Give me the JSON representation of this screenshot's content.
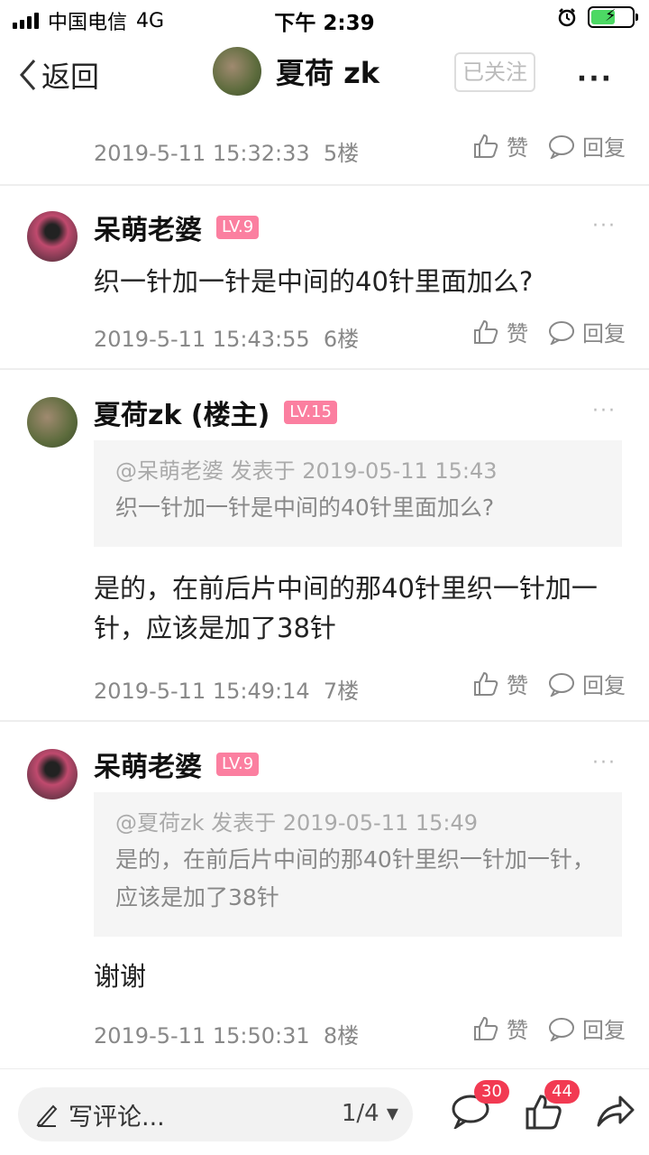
{
  "status_bar": {
    "carrier": "中国电信",
    "network": "4G",
    "time": "下午 2:39"
  },
  "nav": {
    "back_label": "返回",
    "title": "夏荷 zk",
    "follow_label": "已关注",
    "more_label": "···"
  },
  "post0": {
    "time": "2019-5-11 15:32:33",
    "floor": "5楼",
    "like_label": "赞",
    "reply_label": "回复"
  },
  "post1": {
    "name": "呆萌老婆",
    "level": "LV.9",
    "text": "织一针加一针是中间的40针里面加么?",
    "time": "2019-5-11 15:43:55",
    "floor": "6楼",
    "like_label": "赞",
    "reply_label": "回复"
  },
  "post2": {
    "name": "夏荷zk (楼主)",
    "level": "LV.15",
    "quote_head": "@呆萌老婆 发表于 2019-05-11 15:43",
    "quote_text": "织一针加一针是中间的40针里面加么?",
    "text": "是的，在前后片中间的那40针里织一针加一针，应该是加了38针",
    "time": "2019-5-11 15:49:14",
    "floor": "7楼",
    "like_label": "赞",
    "reply_label": "回复"
  },
  "post3": {
    "name": "呆萌老婆",
    "level": "LV.9",
    "quote_head": "@夏荷zk 发表于 2019-05-11 15:49",
    "quote_text": "是的，在前后片中间的那40针里织一针加一针，应该是加了38针",
    "text": "谢谢",
    "time": "2019-5-11 15:50:31",
    "floor": "8楼",
    "like_label": "赞",
    "reply_label": "回复"
  },
  "bottom": {
    "comment_placeholder": "写评论...",
    "page_indicator": "1/4 ▾",
    "comment_count": "30",
    "like_count": "44"
  },
  "colors": {
    "level_badge": "#fb7fa0",
    "count_badge": "#f23a52"
  }
}
